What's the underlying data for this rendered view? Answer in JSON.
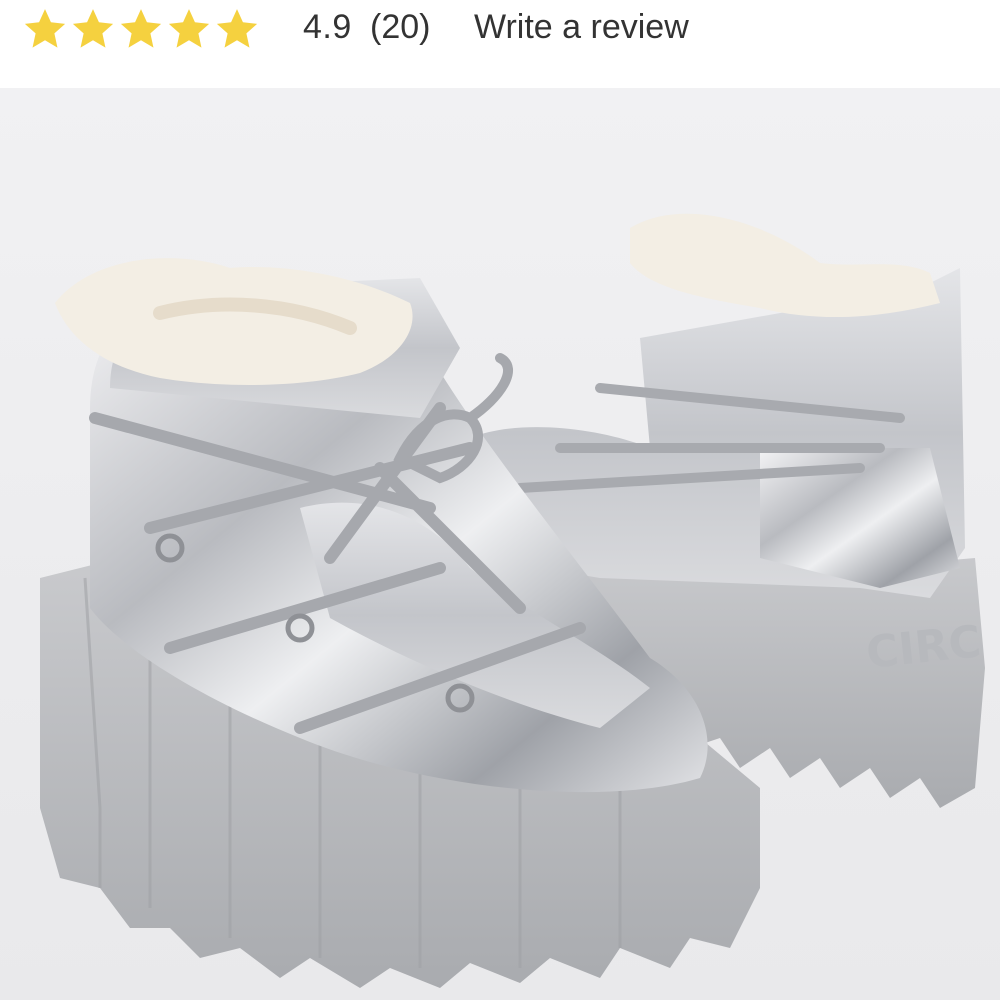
{
  "rating": {
    "stars_filled": 5,
    "stars_total": 5,
    "value": "4.9",
    "count": "(20)",
    "write_review_label": "Write a review",
    "star_color": "#f5d13f"
  },
  "product_image": {
    "sole_text": "CIRC"
  }
}
